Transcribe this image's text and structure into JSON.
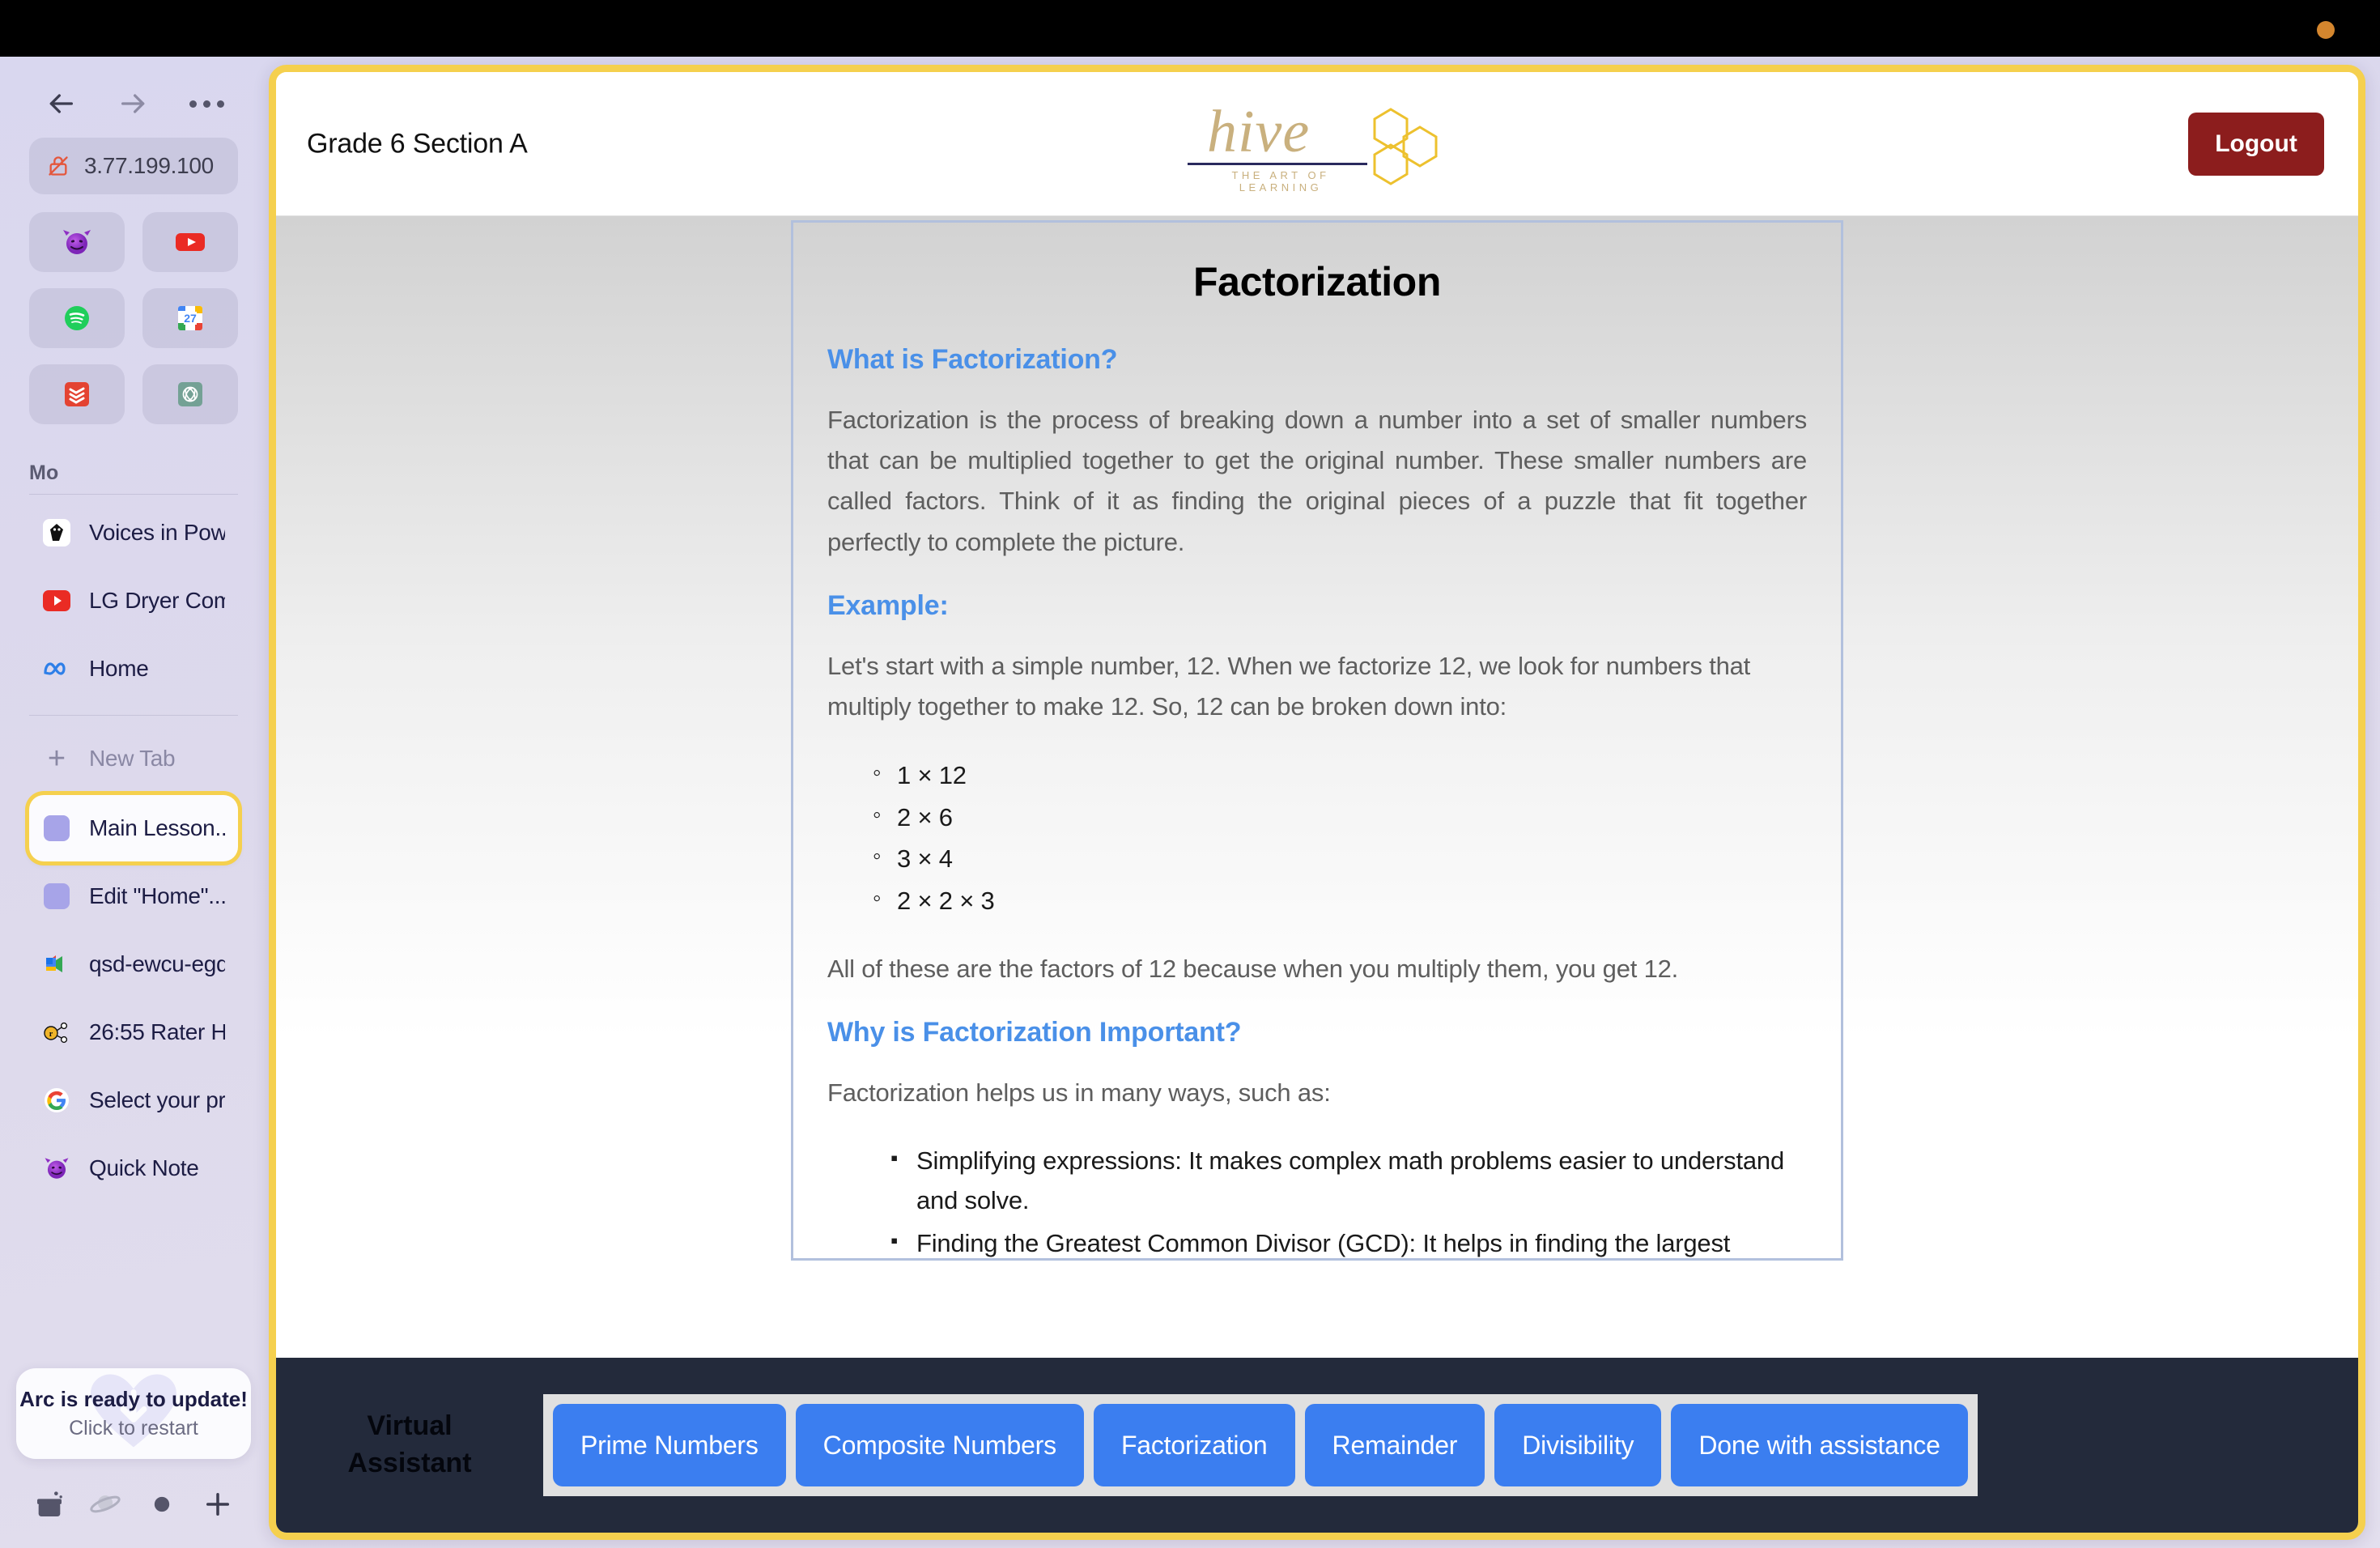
{
  "browser": {
    "url": "3.77.199.100",
    "nav": {
      "back": "back-arrow",
      "forward": "forward-arrow",
      "more": "more-options"
    },
    "favorites": [
      {
        "name": "devil-emoji-tile",
        "glyph": "😈"
      },
      {
        "name": "youtube-tile",
        "glyph": "youtube-icon"
      },
      {
        "name": "spotify-tile",
        "glyph": "spotify-icon"
      },
      {
        "name": "google-calendar-tile",
        "glyph": "calendar-27-icon"
      },
      {
        "name": "todoist-tile",
        "glyph": "todoist-icon"
      },
      {
        "name": "chatgpt-tile",
        "glyph": "openai-icon"
      }
    ],
    "space_name": "Mo",
    "pinned_tabs": [
      {
        "label": "Voices in Pow...",
        "icon": "voices-in-power-icon"
      },
      {
        "label": "LG Dryer Com...",
        "icon": "youtube-icon"
      },
      {
        "label": "Home",
        "icon": "meta-icon"
      }
    ],
    "new_tab_label": "New Tab",
    "tabs": [
      {
        "label": "Main Lesson...",
        "icon": "page-icon",
        "active": true
      },
      {
        "label": "Edit \"Home\"...",
        "icon": "page-icon",
        "active": false
      },
      {
        "label": "qsd-ewcu-egq",
        "icon": "google-meet-icon",
        "active": false
      },
      {
        "label": "26:55 Rater H...",
        "icon": "raterhub-icon",
        "active": false
      },
      {
        "label": "Select your pr...",
        "icon": "google-icon",
        "active": false
      },
      {
        "label": "Quick Note",
        "icon": "devil-emoji-icon",
        "active": false
      }
    ],
    "toast": {
      "title": "Arc is ready to update!",
      "subtitle": "Click to restart"
    },
    "bottom_tools": [
      "archive-icon",
      "spaces-icon",
      "record-icon",
      "new-tab-plus-icon"
    ]
  },
  "site": {
    "header": {
      "class_title": "Grade 6 Section A",
      "logo_word": "hive",
      "logo_tagline": "THE ART OF LEARNING",
      "logout_label": "Logout"
    },
    "lesson": {
      "title": "Factorization",
      "sections": [
        {
          "heading": "What is Factorization?",
          "paragraph": "Factorization is the process of breaking down a number into a set of smaller numbers that can be multiplied together to get the original number. These smaller numbers are called factors. Think of it as finding the original pieces of a puzzle that fit together perfectly to complete the picture."
        },
        {
          "heading": "Example:",
          "paragraph": "Let's start with a simple number, 12. When we factorize 12, we look for numbers that multiply together to make 12. So, 12 can be broken down into:",
          "list": [
            "1 × 12",
            "2 × 6",
            "3 × 4",
            "2 × 2 × 3"
          ],
          "after": "All of these are the factors of 12 because when you multiply them, you get 12."
        },
        {
          "heading": "Why is Factorization Important?",
          "paragraph": "Factorization helps us in many ways, such as:",
          "list": [
            "Simplifying expressions: It makes complex math problems easier to understand and solve.",
            "Finding the Greatest Common Divisor (GCD): It helps in finding the largest"
          ]
        }
      ]
    },
    "assistant": {
      "label_line1": "Virtual",
      "label_line2": "Assistant",
      "chips": [
        "Prime Numbers",
        "Composite Numbers",
        "Factorization",
        "Remainder",
        "Divisibility",
        "Done with assistance"
      ]
    }
  },
  "colors": {
    "frame_yellow": "#f5d04e",
    "logout_red": "#8c1d1d",
    "chip_blue": "#3b7ef0",
    "heading_blue": "#4a90e8",
    "assistant_dark": "#232a3b",
    "logo_gold": "#c9b07e",
    "card_border": "#b2c0dd"
  }
}
